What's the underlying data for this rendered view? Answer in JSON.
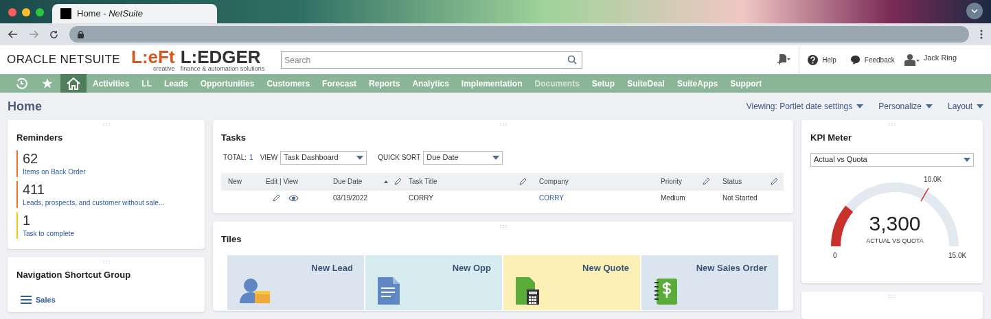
{
  "browser": {
    "tab_title": "Home - ",
    "tab_title_italic": "NetSuite"
  },
  "header": {
    "brand": "ORACLE NETSUITE",
    "logo_left": "L:eFt",
    "logo_left_sub": "creative",
    "logo_right": "L:EDGER",
    "logo_right_sub": "finance & automation solutions",
    "search": {
      "placeholder": "Search"
    },
    "help": "Help",
    "feedback": "Feedback",
    "user": "Jack Ring"
  },
  "nav": [
    {
      "kind": "recent",
      "selected": false
    },
    {
      "kind": "star",
      "selected": false
    },
    {
      "kind": "home",
      "selected": true
    },
    {
      "label": "Activities",
      "disabled": false
    },
    {
      "label": "LL",
      "disabled": false
    },
    {
      "label": "Leads",
      "disabled": false
    },
    {
      "label": "Opportunities",
      "disabled": false
    },
    {
      "label": "Customers",
      "disabled": false
    },
    {
      "label": "Forecast",
      "disabled": false
    },
    {
      "label": "Reports",
      "disabled": false
    },
    {
      "label": "Analytics",
      "disabled": false
    },
    {
      "label": "Implementation",
      "disabled": false
    },
    {
      "label": "Documents",
      "disabled": true
    },
    {
      "label": "Setup",
      "disabled": false
    },
    {
      "label": "SuiteDeal",
      "disabled": false
    },
    {
      "label": "SuiteApps",
      "disabled": false
    },
    {
      "label": "Support",
      "disabled": false
    }
  ],
  "page": {
    "title": "Home",
    "menus": [
      "Viewing: Portlet date settings",
      "Personalize",
      "Layout"
    ]
  },
  "reminders": {
    "title": "Reminders",
    "items": [
      {
        "count": "62",
        "label": "Items on Back Order",
        "color": "#f26c21"
      },
      {
        "count": "411",
        "label": "Leads, prospects, and customer without sale...",
        "color": "#f26c21"
      },
      {
        "count": "1",
        "label": "Task to complete",
        "color": "#f5c518"
      }
    ]
  },
  "shortcuts": {
    "title": "Navigation Shortcut Group",
    "group": "Sales"
  },
  "tasks": {
    "title": "Tasks",
    "total_label": "TOTAL:",
    "total": "1",
    "view_label": "VIEW",
    "view": "Task Dashboard",
    "sort_label": "QUICK SORT",
    "sort": "Due Date",
    "columns": [
      "New",
      "Edit | View",
      "Due Date",
      "Task Title",
      "Company",
      "Priority",
      "Status"
    ],
    "rows": [
      {
        "due": "03/19/2022",
        "title": "CORRY",
        "company": "CORRY",
        "priority": "Medium",
        "status": "Not Started"
      }
    ]
  },
  "tiles": {
    "title": "Tiles",
    "items": [
      {
        "label": "New Lead",
        "kind": "lead",
        "color": "#dbe5f0"
      },
      {
        "label": "New Opp",
        "kind": "opp",
        "color": "#d6ecf1"
      },
      {
        "label": "New Quote",
        "kind": "quote",
        "color": "#fcf0b6"
      },
      {
        "label": "New Sales Order",
        "kind": "order",
        "color": "#dbe5f0"
      }
    ]
  },
  "kpi": {
    "title": "KPI Meter",
    "select": "Actual vs Quota",
    "value": "3,300",
    "caption": "ACTUAL VS QUOTA",
    "min_label": "0",
    "max_label": "15.0K",
    "level": 0.22,
    "target": {
      "label": "10.0K",
      "level": 0.667
    }
  }
}
